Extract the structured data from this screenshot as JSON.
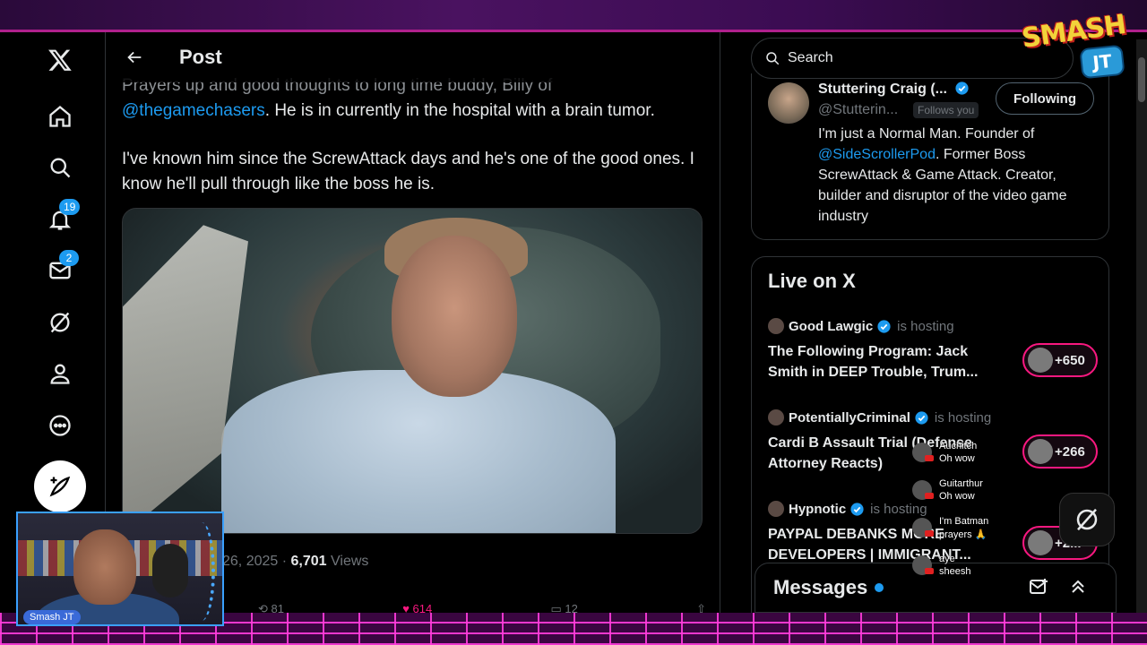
{
  "header": {
    "title": "Post",
    "back_label": "Back"
  },
  "nav": {
    "notifications_count": "19",
    "messages_count": "2"
  },
  "tweet": {
    "line1_prefix": "Prayers up and good thoughts to long time buddy, Billy of",
    "mention": "@thegamechasers",
    "line1_suffix": ". He is in currently in the hospital with a brain tumor.",
    "paragraph2": "I've known him since the ScrewAttack days and he's one of the good ones. I know he'll pull through like the boss he is.",
    "date": "26, 2025",
    "views_count": "6,701",
    "views_label": "Views",
    "reposts": "81",
    "likes": "614",
    "bookmarks": "12"
  },
  "search": {
    "placeholder": "Search"
  },
  "profile": {
    "name": "Stuttering Craig (...",
    "handle": "@Stutterin...",
    "follows_you": "Follows you",
    "following_label": "Following",
    "bio_prefix": "I'm just a Normal Man. Founder of",
    "bio_mention": "@SideScrollerPod",
    "bio_suffix": ". Former Boss ScrewAttack & Game Attack. Creator, builder and disruptor of the video game industry"
  },
  "live": {
    "title": "Live on X",
    "items": [
      {
        "host": "Good Lawgic",
        "status": "is hosting",
        "topic": "The Following Program: Jack Smith in DEEP Trouble, Trum...",
        "listeners": "+650"
      },
      {
        "host": "PotentiallyCriminal",
        "status": "is hosting",
        "topic": "Cardi B Assault Trial (Defense Attorney Reacts)",
        "listeners": "+266"
      },
      {
        "host": "Hypnotic",
        "status": "is hosting",
        "topic": "PAYPAL DEBANKS MORE DEVELOPERS | IMMIGRANT...",
        "listeners": "+2..."
      }
    ]
  },
  "messages": {
    "title": "Messages"
  },
  "stream": {
    "cam_label": "Smash JT",
    "logo_text": "SMASH",
    "logo_badge": "JT",
    "chat": [
      {
        "user": "Auchitch",
        "text": "Oh wow"
      },
      {
        "user": "Guitarthur",
        "text": "Oh wow"
      },
      {
        "user": "I'm Batman",
        "text": "prayers 🙏"
      },
      {
        "user": "aye",
        "text": "sheesh"
      }
    ]
  },
  "icons": {
    "nav": [
      "x-logo-icon",
      "home-icon",
      "search-icon",
      "bell-icon",
      "mail-icon",
      "grok-icon",
      "profile-icon",
      "more-icon",
      "compose-icon"
    ]
  },
  "colors": {
    "accent": "#1d9bf0",
    "like": "#f91880",
    "background": "#000000"
  }
}
